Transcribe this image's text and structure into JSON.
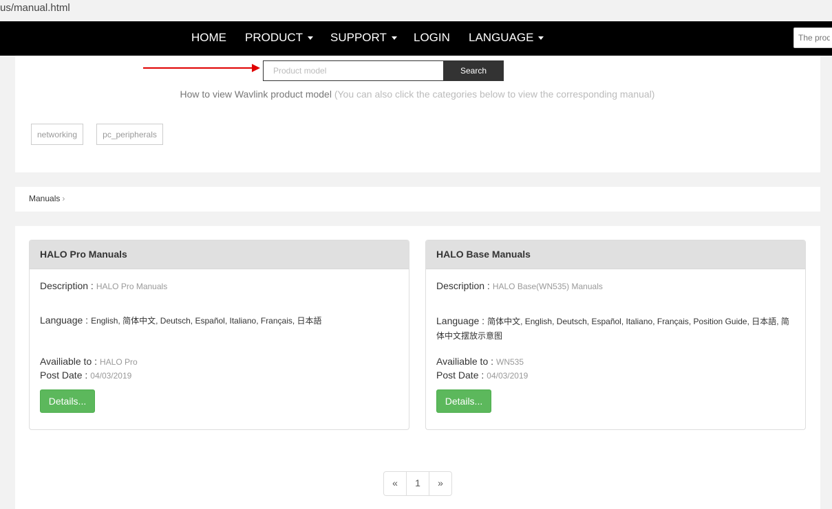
{
  "browser": {
    "url_fragment": "us/manual.html"
  },
  "nav": {
    "items": [
      {
        "label": "HOME",
        "dropdown": false
      },
      {
        "label": "PRODUCT",
        "dropdown": true
      },
      {
        "label": "SUPPORT",
        "dropdown": true
      },
      {
        "label": "LOGIN",
        "dropdown": false
      },
      {
        "label": "LANGUAGE",
        "dropdown": true
      }
    ],
    "search_placeholder": "The product"
  },
  "search": {
    "placeholder": "Product model",
    "button_label": "Search",
    "howto_text": "How to view Wavlink product model",
    "howto_hint": "(You can also click the categories below to view the corresponding manual)",
    "arrow_color": "#e00000"
  },
  "categories": [
    "networking",
    "pc_peripherals"
  ],
  "breadcrumb": {
    "label": "Manuals",
    "separator": "›"
  },
  "labels": {
    "description": "Description :",
    "language": "Language :",
    "available": "Availiable to :",
    "post_date": "Post Date :"
  },
  "manuals": [
    {
      "title": "HALO Pro Manuals",
      "description": "HALO Pro Manuals",
      "languages": "English, 简体中文, Deutsch, Español, Italiano, Français, 日本語",
      "available_to": "HALO Pro",
      "post_date": "04/03/2019",
      "button_label": "Details..."
    },
    {
      "title": "HALO Base Manuals",
      "description": "HALO Base(WN535) Manuals",
      "languages": "简体中文, English, Deutsch, Español, Italiano, Français, Position Guide, 日本語, 简体中文摆放示意图",
      "available_to": "WN535",
      "post_date": "04/03/2019",
      "button_label": "Details..."
    }
  ],
  "pagination": {
    "prev": "«",
    "page": "1",
    "next": "»"
  },
  "colors": {
    "navbar": "#000000",
    "details_button": "#5cb85c"
  }
}
